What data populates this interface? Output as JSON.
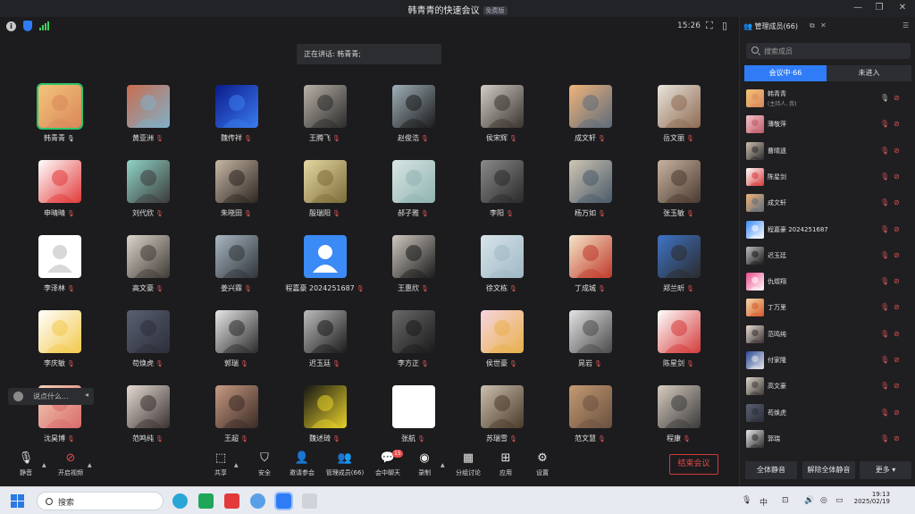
{
  "window": {
    "title": "韩青青的快速会议",
    "badge": "免费版"
  },
  "topbar": {
    "time": "15:26"
  },
  "speaking": "正在讲话: 韩青青;",
  "tiles": [
    {
      "name": "韩青青",
      "active": true,
      "mic": "on",
      "c1": "#f3c57a",
      "c2": "#d9875a"
    },
    {
      "name": "黄亚洲",
      "mic": "off",
      "c1": "#c96d50",
      "c2": "#7fb0c8"
    },
    {
      "name": "魏传祥",
      "mic": "off",
      "c1": "#0b1a8a",
      "c2": "#3a7cf0"
    },
    {
      "name": "王腾飞",
      "mic": "off",
      "c1": "#b9b2a8",
      "c2": "#2b2b2b"
    },
    {
      "name": "赵俊浩",
      "mic": "off",
      "c1": "#9fb0b8",
      "c2": "#1b1b1b"
    },
    {
      "name": "侯宋辉",
      "mic": "off",
      "c1": "#d2cdc6",
      "c2": "#3a342f"
    },
    {
      "name": "成文轩",
      "mic": "off",
      "c1": "#f0b47a",
      "c2": "#5d6b7a"
    },
    {
      "name": "岳文丽",
      "mic": "off",
      "c1": "#eae4dc",
      "c2": "#8d6a52"
    },
    {
      "name": "申晴晴",
      "mic": "off",
      "c1": "#ffffff",
      "c2": "#e23a3a"
    },
    {
      "name": "刘代欣",
      "mic": "off",
      "c1": "#8fd4c6",
      "c2": "#3b3b3b"
    },
    {
      "name": "朱晓田",
      "mic": "off",
      "c1": "#c7b8a6",
      "c2": "#2d2520"
    },
    {
      "name": "殷瑞阳",
      "mic": "off",
      "c1": "#e6d8a2",
      "c2": "#7c6c3a"
    },
    {
      "name": "郝子雅",
      "mic": "off",
      "c1": "#d9e6e4",
      "c2": "#8fb3b0"
    },
    {
      "name": "李阳",
      "mic": "off",
      "c1": "#8a8a8a",
      "c2": "#2a2a2a"
    },
    {
      "name": "杨万如",
      "mic": "off",
      "c1": "#cfc6b4",
      "c2": "#4a5a6a"
    },
    {
      "name": "张玉敏",
      "mic": "off",
      "c1": "#c8b3a0",
      "c2": "#4a3a30"
    },
    {
      "name": "李泽林",
      "mic": "off",
      "c1": "#ffffff",
      "c2": "#d8d8d8",
      "placeholder": "grey"
    },
    {
      "name": "高文豪",
      "mic": "off",
      "c1": "#dcd5cc",
      "c2": "#3f3a35"
    },
    {
      "name": "姜兴霖",
      "mic": "off",
      "c1": "#a9b6c2",
      "c2": "#2f3439"
    },
    {
      "name": "程嘉豪 2024251687",
      "mic": "off",
      "c1": "#3b8af5",
      "c2": "#ffffff",
      "placeholder": "blue"
    },
    {
      "name": "王惠欣",
      "mic": "off",
      "c1": "#cfc8c0",
      "c2": "#1a1a1a"
    },
    {
      "name": "徐文栋",
      "mic": "off",
      "c1": "#d7e4ea",
      "c2": "#9fb8c4"
    },
    {
      "name": "丁成城",
      "mic": "off",
      "c1": "#f4e6c8",
      "c2": "#c0392b"
    },
    {
      "name": "郑兰昕",
      "mic": "off",
      "c1": "#3e74c8",
      "c2": "#2b2b2b"
    },
    {
      "name": "李庆敏",
      "mic": "off",
      "c1": "#ffffff",
      "c2": "#f2c94c"
    },
    {
      "name": "苟焕虎",
      "mic": "off",
      "c1": "#5a5f70",
      "c2": "#2c2f3a"
    },
    {
      "name": "郭瑞",
      "mic": "off",
      "c1": "#e8e8e8",
      "c2": "#2a2a2a"
    },
    {
      "name": "迟玉廷",
      "mic": "off",
      "c1": "#bcbcbc",
      "c2": "#1a1a1a"
    },
    {
      "name": "李方正",
      "mic": "off",
      "c1": "#6a6a6a",
      "c2": "#1a1a1a"
    },
    {
      "name": "侯世豪",
      "mic": "off",
      "c1": "#f7d5e0",
      "c2": "#e8b04a"
    },
    {
      "name": "晁岩",
      "mic": "off",
      "c1": "#e4e4e4",
      "c2": "#4a4a4a"
    },
    {
      "name": "陈星剑",
      "mic": "off",
      "c1": "#ffffff",
      "c2": "#d43a3a"
    },
    {
      "name": "沈昊博",
      "mic": "off",
      "c1": "#f3d0b8",
      "c2": "#d86a6a"
    },
    {
      "name": "范鸣纯",
      "mic": "off",
      "c1": "#e6dcd4",
      "c2": "#3a3030"
    },
    {
      "name": "王超",
      "mic": "off",
      "c1": "#c79a82",
      "c2": "#3a2a25"
    },
    {
      "name": "魏述琦",
      "mic": "off",
      "c1": "#151515",
      "c2": "#e8d22a"
    },
    {
      "name": "张航",
      "mic": "off",
      "c1": "#ffffff",
      "c2": "#ffffff"
    },
    {
      "name": "苏瑞雪",
      "mic": "off",
      "c1": "#cbbfae",
      "c2": "#4a3a2a"
    },
    {
      "name": "范文慧",
      "mic": "off",
      "c1": "#c39a72",
      "c2": "#6b5040"
    },
    {
      "name": "程康",
      "mic": "off",
      "c1": "#d8ccc0",
      "c2": "#3a3a3a"
    }
  ],
  "chat_hint": "说点什么...",
  "toolbar": {
    "mute": "静音",
    "video": "开启视频",
    "share": "共享",
    "security": "安全",
    "invite": "邀请参会",
    "members": "管理成员(66)",
    "chat": "会中聊天",
    "chat_count": "15",
    "record": "录制",
    "breakout": "分组讨论",
    "apps": "应用",
    "settings": "设置",
    "end": "结束会议"
  },
  "panel": {
    "title": "管理成员(66)",
    "search_placeholder": "搜索成员",
    "tab_in": "会议中·66",
    "tab_out": "未进入",
    "members": [
      {
        "name": "韩青青",
        "sub": "(主持人, 我)",
        "mic": "on",
        "c1": "#f3c57a",
        "c2": "#d9875a"
      },
      {
        "name": "薄敬萍",
        "mic": "off",
        "c1": "#f2c3c8",
        "c2": "#c05a6a"
      },
      {
        "name": "曹晴遗",
        "mic": "off",
        "c1": "#cfc0b0",
        "c2": "#2a2a2a"
      },
      {
        "name": "陈星剑",
        "mic": "off",
        "c1": "#ffffff",
        "c2": "#d43a3a"
      },
      {
        "name": "成文轩",
        "mic": "off",
        "c1": "#f0b47a",
        "c2": "#5d6b7a"
      },
      {
        "name": "程嘉豪 2024251687",
        "mic": "off",
        "c1": "#3b8af5",
        "c2": "#ffffff"
      },
      {
        "name": "迟玉廷",
        "mic": "off",
        "c1": "#bcbcbc",
        "c2": "#1a1a1a"
      },
      {
        "name": "仇煜翔",
        "mic": "off",
        "c1": "#e94a8a",
        "c2": "#ffffff"
      },
      {
        "name": "丁万里",
        "mic": "off",
        "c1": "#f4d9a8",
        "c2": "#d45a2a"
      },
      {
        "name": "范鸣纯",
        "mic": "off",
        "c1": "#e6dcd4",
        "c2": "#3a3030"
      },
      {
        "name": "付家隆",
        "mic": "off",
        "c1": "#2a4a9a",
        "c2": "#e8e8e8"
      },
      {
        "name": "高文豪",
        "mic": "off",
        "c1": "#dcd5cc",
        "c2": "#3f3a35"
      },
      {
        "name": "苟焕虎",
        "mic": "off",
        "c1": "#5a5f70",
        "c2": "#2c2f3a"
      },
      {
        "name": "郭瑞",
        "mic": "off",
        "c1": "#e8e8e8",
        "c2": "#2a2a2a"
      }
    ],
    "btn_mute_all": "全体静音",
    "btn_unmute_all": "解除全体静音",
    "btn_more": "更多"
  },
  "taskbar": {
    "search_placeholder": "搜索",
    "time": "19:13",
    "date": "2025/02/19"
  }
}
